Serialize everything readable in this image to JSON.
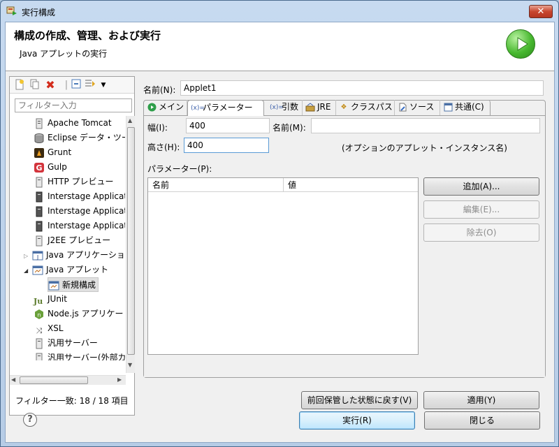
{
  "window": {
    "title": "実行構成",
    "close_label": "✕"
  },
  "header": {
    "title": "構成の作成、管理、および実行",
    "subtitle": "Java アプレットの実行"
  },
  "left": {
    "filter_placeholder": "フィルター入力",
    "tree": [
      {
        "label": "Apache Tomcat",
        "icon": "server-icon"
      },
      {
        "label": "Eclipse データ・ツー",
        "icon": "database-icon"
      },
      {
        "label": "Grunt",
        "icon": "grunt-icon"
      },
      {
        "label": "Gulp",
        "icon": "gulp-icon"
      },
      {
        "label": "HTTP プレビュー",
        "icon": "server-icon"
      },
      {
        "label": "Interstage Applicat",
        "icon": "server-dark-icon"
      },
      {
        "label": "Interstage Applicat",
        "icon": "server-dark-icon"
      },
      {
        "label": "Interstage Applicat",
        "icon": "server-dark-icon"
      },
      {
        "label": "J2EE プレビュー",
        "icon": "server-icon"
      },
      {
        "label": "Java アプリケーショ",
        "icon": "java-app-icon"
      },
      {
        "label": "Java アプレット",
        "icon": "applet-icon"
      },
      {
        "label": "新規構成",
        "icon": "applet-icon"
      },
      {
        "label": "JUnit",
        "icon": "junit-icon"
      },
      {
        "label": "Node.js アプリケー",
        "icon": "nodejs-icon"
      },
      {
        "label": "XSL",
        "icon": "xsl-icon"
      },
      {
        "label": "汎用サーバー",
        "icon": "server-icon"
      },
      {
        "label": "汎用サーバー(外部カ",
        "icon": "server-icon"
      }
    ],
    "filter_count": "フィルター一致: 18 / 18 項目"
  },
  "right": {
    "name_label": "名前(N):",
    "name_value": "Applet1",
    "tabs": [
      "メイン",
      "パラメーター",
      "引数",
      "JRE",
      "クラスパス",
      "ソース",
      "共通(C)"
    ],
    "width_label": "幅(I):",
    "width_value": "400",
    "applet_name_label": "名前(M):",
    "applet_name_value": "",
    "height_label": "高さ(H):",
    "height_value": "400",
    "note": "(オプションのアプレット・インスタンス名)",
    "params_label": "パラメーター(P):",
    "col_name": "名前",
    "col_value": "値",
    "add_button": "追加(A)...",
    "edit_button": "編集(E)...",
    "remove_button": "除去(O)",
    "revert_button": "前回保管した状態に戻す(V)",
    "apply_button": "適用(Y)"
  },
  "footer": {
    "run_button": "実行(R)",
    "close_button": "閉じる",
    "help": "?"
  },
  "colors": {
    "accent": "#3c7fb1",
    "run_green": "#48b830",
    "title_bar": "#b6cce6"
  }
}
